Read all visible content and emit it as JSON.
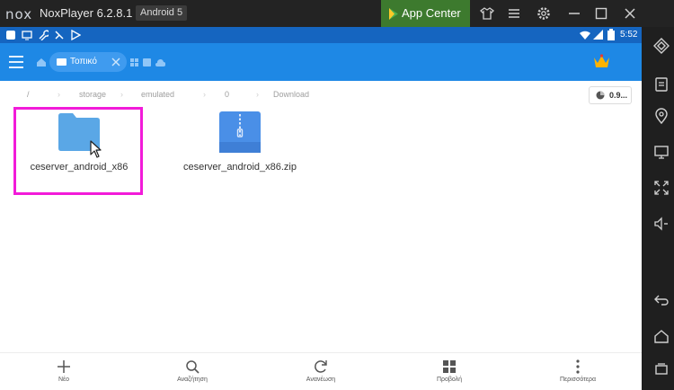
{
  "window": {
    "logo": "nox",
    "title": "NoxPlayer 6.2.8.1",
    "android_version": "Android 5",
    "app_center_label": "App Center"
  },
  "statusbar": {
    "time": "5:52"
  },
  "appbar": {
    "tab_label": "Τοπικό",
    "accent_color": "#1e88e5"
  },
  "breadcrumb": {
    "segments": [
      "/",
      "storage",
      "emulated",
      "0",
      "Download"
    ],
    "storage_label": "0.9..."
  },
  "files": [
    {
      "name": "ceserver_android_x86",
      "type": "folder-icon"
    },
    {
      "name": "ceserver_android_x86.zip",
      "type": "zip-icon"
    }
  ],
  "bottom_nav": [
    {
      "label": "Νέο",
      "icon": "plus-icon"
    },
    {
      "label": "Αναζήτηση",
      "icon": "search-icon"
    },
    {
      "label": "Ανανέωση",
      "icon": "refresh-icon"
    },
    {
      "label": "Προβολή",
      "icon": "grid-icon"
    },
    {
      "label": "Περισσότερα",
      "icon": "more-vert-icon"
    }
  ],
  "highlight_color": "#f21bd9"
}
